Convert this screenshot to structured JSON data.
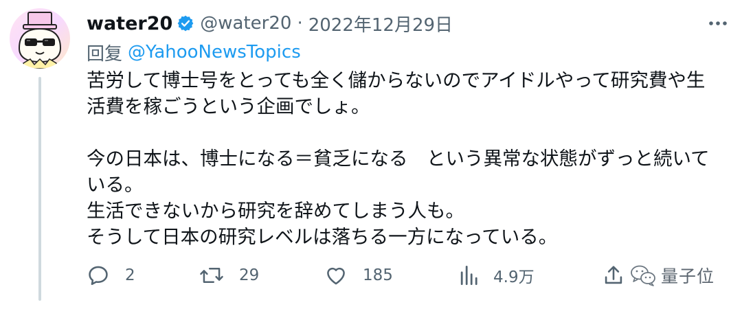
{
  "tweet": {
    "author": {
      "display_name": "water20",
      "handle": "@water20",
      "verified": true,
      "avatar_icon": "top-hat-sunglasses-face-avatar"
    },
    "separator": "·",
    "date": "2022年12月29日",
    "reply_label": "回复",
    "reply_to": "@YahooNewsTopics",
    "body_lines": [
      "苦労して博士号をとっても全く儲からないのでアイドルやって研究費や生",
      "活費を稼ごうという企画でしょ。",
      "",
      "今の日本は、博士になる＝貧乏になる　という異常な状態がずっと続いて",
      "いる。",
      "生活できないから研究を辞めてしまう人も。",
      "そうして日本の研究レベルは落ちる一方になっている。"
    ],
    "stats": {
      "replies": "2",
      "retweets": "29",
      "likes": "185",
      "views": "4.9万"
    },
    "icons": {
      "reply": "reply-icon",
      "retweet": "retweet-icon",
      "like": "heart-icon",
      "views": "views-icon",
      "share": "share-icon",
      "more": "more-icon",
      "verified": "verified-badge-icon"
    }
  },
  "watermark": {
    "text": "量子位",
    "icon": "wechat-icon"
  },
  "colors": {
    "text": "#0f1419",
    "secondary": "#536471",
    "accent": "#1d9bf0",
    "thread_line": "#cfd9de"
  }
}
